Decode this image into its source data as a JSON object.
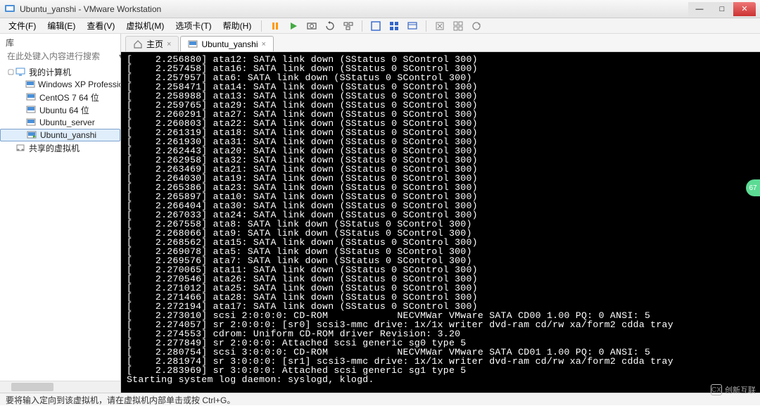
{
  "window": {
    "title": "Ubuntu_yanshi - VMware Workstation"
  },
  "menu": {
    "file": "文件(F)",
    "edit": "编辑(E)",
    "view": "查看(V)",
    "vm": "虚拟机(M)",
    "tabs": "选项卡(T)",
    "help": "帮助(H)"
  },
  "sidebar": {
    "header": "库",
    "search_placeholder": "在此处键入内容进行搜索",
    "nodes": {
      "my_computer": "我的计算机",
      "win_xp": "Windows XP Professio",
      "centos": "CentOS 7 64 位",
      "ubuntu64": "Ubuntu 64 位",
      "ubuntu_server": "Ubuntu_server",
      "ubuntu_yanshi": "Ubuntu_yanshi",
      "shared": "共享的虚拟机"
    }
  },
  "tabs": {
    "home": "主页",
    "vm": "Ubuntu_yanshi"
  },
  "terminal_lines": [
    "[    2.256880] ata12: SATA link down (SStatus 0 SControl 300)",
    "[    2.257458] ata16: SATA link down (SStatus 0 SControl 300)",
    "[    2.257957] ata6: SATA link down (SStatus 0 SControl 300)",
    "[    2.258471] ata14: SATA link down (SStatus 0 SControl 300)",
    "[    2.258988] ata13: SATA link down (SStatus 0 SControl 300)",
    "[    2.259765] ata29: SATA link down (SStatus 0 SControl 300)",
    "[    2.260291] ata27: SATA link down (SStatus 0 SControl 300)",
    "[    2.260803] ata22: SATA link down (SStatus 0 SControl 300)",
    "[    2.261319] ata18: SATA link down (SStatus 0 SControl 300)",
    "[    2.261930] ata31: SATA link down (SStatus 0 SControl 300)",
    "[    2.262443] ata20: SATA link down (SStatus 0 SControl 300)",
    "[    2.262958] ata32: SATA link down (SStatus 0 SControl 300)",
    "[    2.263469] ata21: SATA link down (SStatus 0 SControl 300)",
    "[    2.264030] ata19: SATA link down (SStatus 0 SControl 300)",
    "[    2.265386] ata23: SATA link down (SStatus 0 SControl 300)",
    "[    2.265897] ata10: SATA link down (SStatus 0 SControl 300)",
    "[    2.266404] ata30: SATA link down (SStatus 0 SControl 300)",
    "[    2.267033] ata24: SATA link down (SStatus 0 SControl 300)",
    "[    2.267558] ata8: SATA link down (SStatus 0 SControl 300)",
    "[    2.268066] ata9: SATA link down (SStatus 0 SControl 300)",
    "[    2.268562] ata15: SATA link down (SStatus 0 SControl 300)",
    "[    2.269078] ata5: SATA link down (SStatus 0 SControl 300)",
    "[    2.269576] ata7: SATA link down (SStatus 0 SControl 300)",
    "[    2.270065] ata11: SATA link down (SStatus 0 SControl 300)",
    "[    2.270546] ata26: SATA link down (SStatus 0 SControl 300)",
    "[    2.271012] ata25: SATA link down (SStatus 0 SControl 300)",
    "[    2.271466] ata28: SATA link down (SStatus 0 SControl 300)",
    "[    2.272194] ata17: SATA link down (SStatus 0 SControl 300)",
    "[    2.273010] scsi 2:0:0:0: CD-ROM            NECVMWar VMware SATA CD00 1.00 PQ: 0 ANSI: 5",
    "[    2.274057] sr 2:0:0:0: [sr0] scsi3-mmc drive: 1x/1x writer dvd-ram cd/rw xa/form2 cdda tray",
    "[    2.274553] cdrom: Uniform CD-ROM driver Revision: 3.20",
    "[    2.277849] sr 2:0:0:0: Attached scsi generic sg0 type 5",
    "[    2.280754] scsi 3:0:0:0: CD-ROM            NECVMWar VMware SATA CD01 1.00 PQ: 0 ANSI: 5",
    "[    2.281974] sr 3:0:0:0: [sr1] scsi3-mmc drive: 1x/1x writer dvd-ram cd/rw xa/form2 cdda tray",
    "[    2.283969] sr 3:0:0:0: Attached scsi generic sg1 type 5",
    "Starting system log daemon: syslogd, klogd."
  ],
  "status": "要将输入定向到该虚拟机，请在虚拟机内部单击或按 Ctrl+G。",
  "watermark": "创新互联",
  "badge": "67"
}
